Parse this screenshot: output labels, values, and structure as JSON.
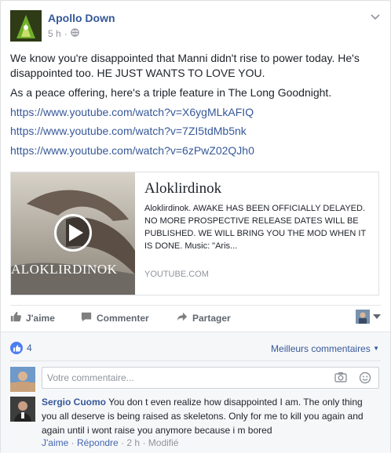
{
  "post": {
    "author": "Apollo Down",
    "time": "5 h",
    "paragraphs": [
      "We know you're disappointed that Manni didn't rise to power today. He's disappointed too. HE JUST WANTS TO LOVE YOU.",
      "As a peace offering, here's a triple feature in The Long Goodnight."
    ],
    "links": [
      "https://www.youtube.com/watch?v=X6ygMLkAFIQ",
      "https://www.youtube.com/watch?v=7ZI5tdMb5nk",
      "https://www.youtube.com/watch?v=6zPwZ02QJh0"
    ]
  },
  "attachment": {
    "thumb_text": "ALOKLIRDINOK",
    "title": "Aloklirdinok",
    "description": "Aloklirdinok. AWAKE HAS BEEN OFFICIALLY DELAYED. NO MORE PROSPECTIVE RELEASE DATES WILL BE PUBLISHED. WE WILL BRING YOU THE MOD WHEN IT IS DONE. Music: \"Aris...",
    "domain": "YOUTUBE.COM"
  },
  "actions": {
    "like": "J'aime",
    "comment": "Commenter",
    "share": "Partager"
  },
  "reactions": {
    "count": "4",
    "sort_label": "Meilleurs commentaires"
  },
  "composer": {
    "placeholder": "Votre commentaire..."
  },
  "comment": {
    "author": "Sergio Cuomo",
    "text": " You don t even realize how disappointed I am. The only thing you all deserve is being raised as skeletons. Only for me to kill you again and again until i wont raise you anymore because i m bored",
    "like": "J'aime",
    "reply": "Répondre",
    "time": "2 h",
    "edited": "Modifié",
    "dot": "·"
  },
  "colors": {
    "link": "#365899",
    "muted": "#90949c",
    "like_blue": "#4c7ef0"
  }
}
